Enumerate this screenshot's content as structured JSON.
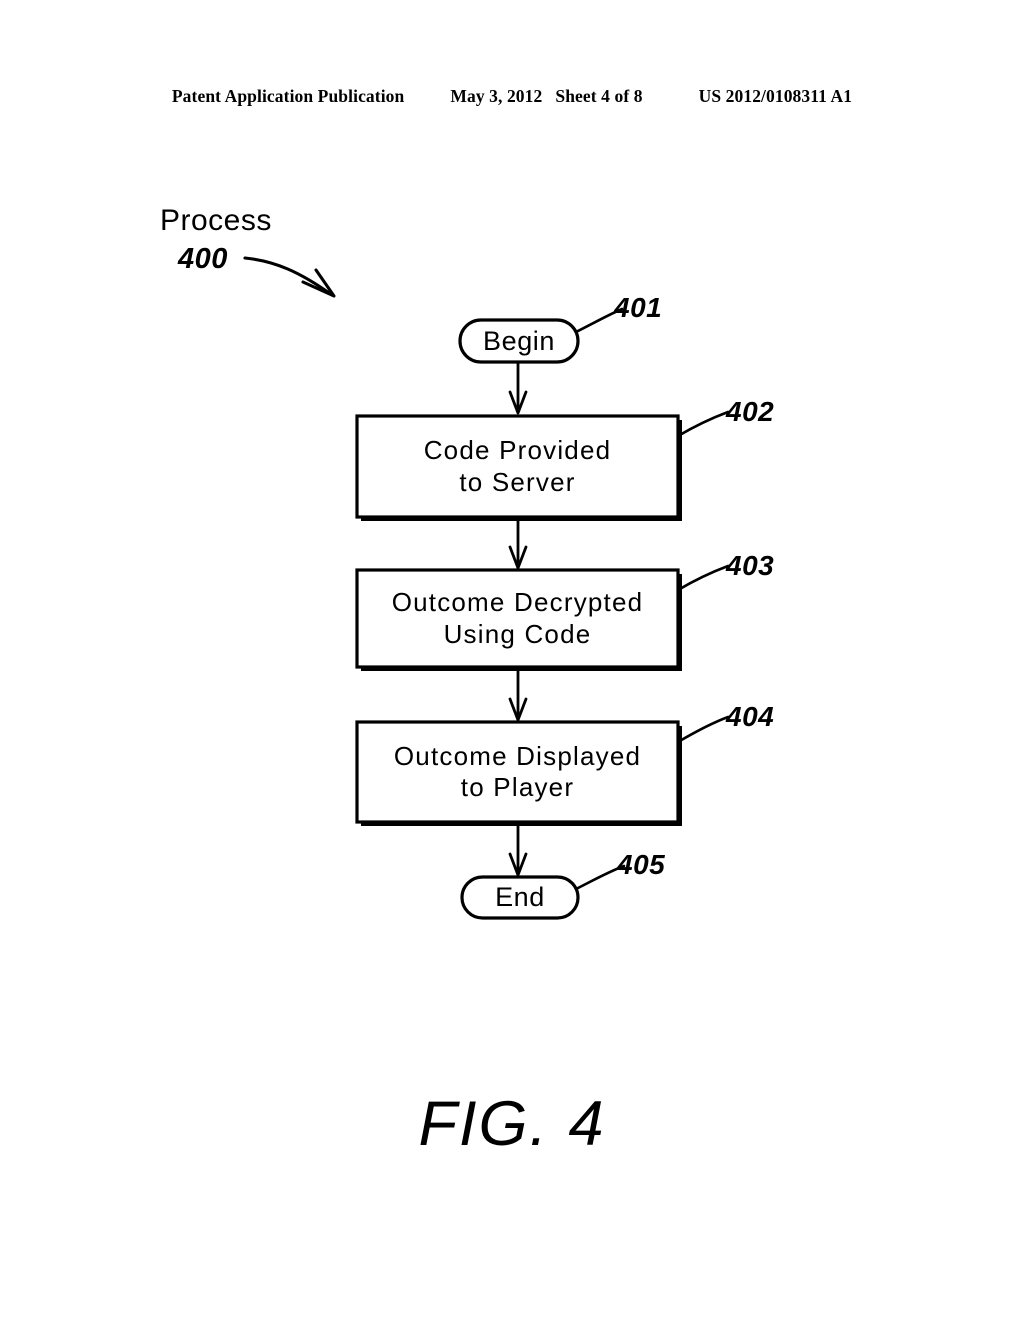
{
  "header": {
    "publication": "Patent Application Publication",
    "date": "May 3, 2012",
    "sheet": "Sheet 4 of 8",
    "patent_number": "US 2012/0108311 A1"
  },
  "figure": {
    "caption": "FIG.  4",
    "process_label": "Process",
    "process_number": "400",
    "ink_color": "#000000",
    "background_color": "#ffffff"
  },
  "flowchart": {
    "nodes": [
      {
        "id": "begin",
        "shape": "stadium",
        "label": "Begin",
        "ref": "401"
      },
      {
        "id": "code-provided-to-server",
        "shape": "process-box",
        "label": "Code Provided\nto Server",
        "line1": "Code Provided",
        "line2": "to Server",
        "ref": "402"
      },
      {
        "id": "outcome-decrypted-using-code",
        "shape": "process-box",
        "label": "Outcome Decrypted\nUsing Code",
        "line1": "Outcome Decrypted",
        "line2": "Using Code",
        "ref": "403"
      },
      {
        "id": "outcome-displayed-to-player",
        "shape": "process-box",
        "label": "Outcome Displayed\nto Player",
        "line1": "Outcome Displayed",
        "line2": "to Player",
        "ref": "404"
      },
      {
        "id": "end",
        "shape": "stadium",
        "label": "End",
        "ref": "405"
      }
    ],
    "connectors": [
      {
        "from": "begin",
        "to": "code-provided-to-server",
        "style": "arrow-down"
      },
      {
        "from": "code-provided-to-server",
        "to": "outcome-decrypted-using-code",
        "style": "arrow-down"
      },
      {
        "from": "outcome-decrypted-using-code",
        "to": "outcome-displayed-to-player",
        "style": "arrow-down"
      },
      {
        "from": "outcome-displayed-to-player",
        "to": "end",
        "style": "arrow-down"
      }
    ]
  }
}
